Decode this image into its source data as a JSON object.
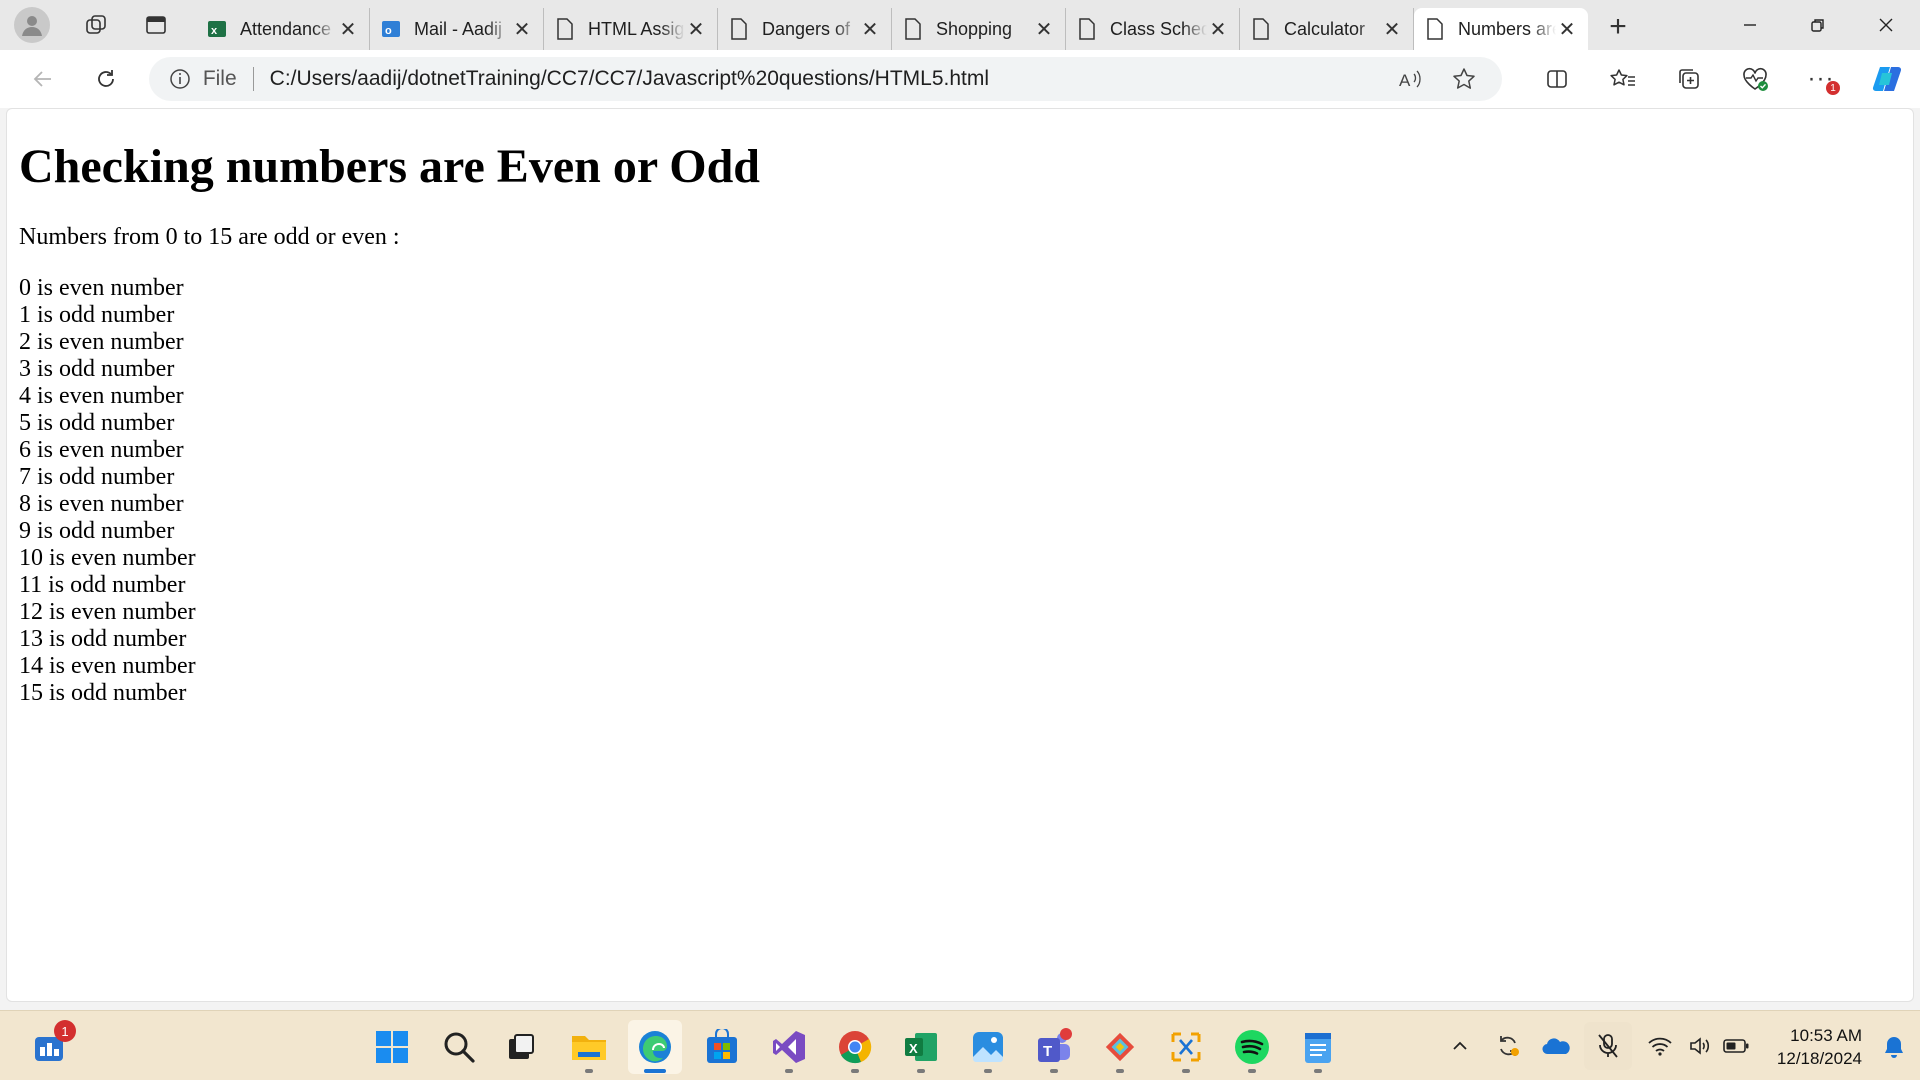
{
  "browser": {
    "tabs": [
      {
        "title": "Attendance",
        "icon": "excel-icon",
        "active": false
      },
      {
        "title": "Mail - Aadij",
        "icon": "outlook-icon",
        "active": false
      },
      {
        "title": "HTML Assignment",
        "icon": "page-icon",
        "active": false
      },
      {
        "title": "Dangers of",
        "icon": "page-icon",
        "active": false
      },
      {
        "title": "Shopping",
        "icon": "page-icon",
        "active": false
      },
      {
        "title": "Class Schedule",
        "icon": "page-icon",
        "active": false
      },
      {
        "title": "Calculator",
        "icon": "page-icon",
        "active": false
      },
      {
        "title": "Numbers are",
        "icon": "page-icon",
        "active": true
      }
    ],
    "address": {
      "scheme_label": "File",
      "url": "C:/Users/aadij/dotnetTraining/CC7/CC7/Javascript%20questions/HTML5.html"
    },
    "toolbar_badge": "1"
  },
  "page": {
    "heading": "Checking numbers are Even or Odd",
    "intro": "Numbers from 0 to 15 are odd or even :",
    "results": [
      "0 is even number",
      "1 is odd number",
      "2 is even number",
      "3 is odd number",
      "4 is even number",
      "5 is odd number",
      "6 is even number",
      "7 is odd number",
      "8 is even number",
      "9 is odd number",
      "10 is even number",
      "11 is odd number",
      "12 is even number",
      "13 is odd number",
      "14 is even number",
      "15 is odd number"
    ]
  },
  "taskbar": {
    "widgets_badge": "1",
    "apps": [
      {
        "name": "windows-start-icon",
        "active": false
      },
      {
        "name": "search-icon",
        "active": false
      },
      {
        "name": "task-view-icon",
        "active": false
      },
      {
        "name": "file-explorer-icon",
        "active": false
      },
      {
        "name": "edge-icon",
        "active": true
      },
      {
        "name": "microsoft-store-icon",
        "active": false
      },
      {
        "name": "visual-studio-icon",
        "active": false
      },
      {
        "name": "chrome-icon",
        "active": false
      },
      {
        "name": "excel-icon",
        "active": false
      },
      {
        "name": "photos-icon",
        "active": false
      },
      {
        "name": "teams-icon",
        "active": false
      },
      {
        "name": "git-icon",
        "active": false
      },
      {
        "name": "snipping-tool-icon",
        "active": false
      },
      {
        "name": "spotify-icon",
        "active": false
      },
      {
        "name": "notepad-icon",
        "active": false
      }
    ],
    "clock": {
      "time": "10:53 AM",
      "date": "12/18/2024"
    }
  }
}
